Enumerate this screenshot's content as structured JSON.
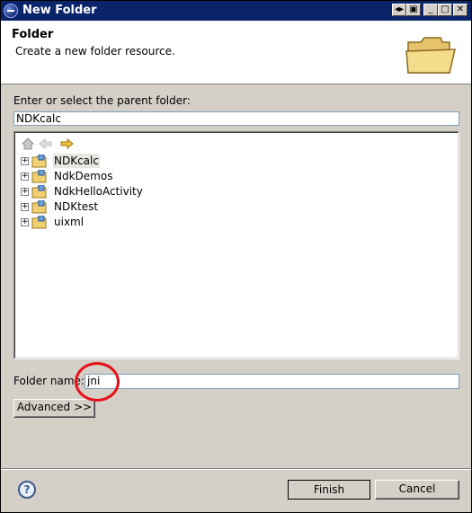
{
  "window": {
    "title": "New Folder",
    "controls": {
      "restore": "◂▸",
      "pin": "🗖",
      "minimize": "_",
      "maximize": "□",
      "close": "✕"
    }
  },
  "header": {
    "title": "Folder",
    "description": "Create a new folder resource."
  },
  "parent": {
    "label": "Enter or select the parent folder:",
    "value": "NDKcalc"
  },
  "tree": {
    "nav": [
      "home-icon",
      "back-arrow-icon",
      "forward-arrow-icon"
    ],
    "items": [
      {
        "label": "NDKcalc",
        "selected": true
      },
      {
        "label": "NdkDemos",
        "selected": false
      },
      {
        "label": "NdkHelloActivity",
        "selected": false
      },
      {
        "label": "NDKtest",
        "selected": false
      },
      {
        "label": "uixml",
        "selected": false
      }
    ]
  },
  "folder_name": {
    "label": "Folder name:",
    "value": "jni"
  },
  "buttons": {
    "advanced": "Advanced >>",
    "finish": "Finish",
    "cancel": "Cancel"
  },
  "colors": {
    "titlebar": "#0a246a",
    "dialog": "#d4d0c8",
    "annotation_circle": "#e8101a"
  }
}
